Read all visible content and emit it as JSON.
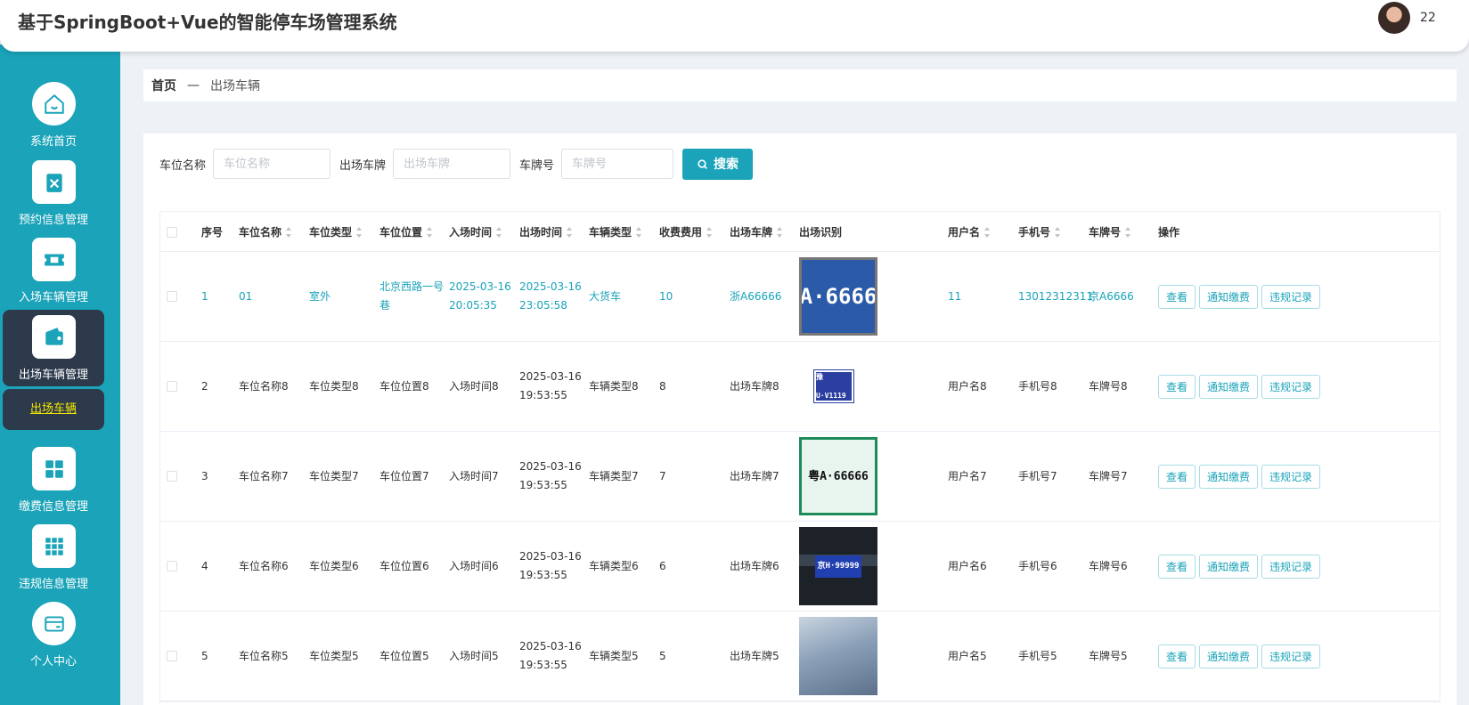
{
  "header": {
    "title": "基于SpringBoot+Vue的智能停车场管理系统",
    "user_name": "22"
  },
  "sidebar": {
    "items": [
      {
        "label": "系统首页",
        "icon": "home-icon"
      },
      {
        "label": "预约信息管理",
        "icon": "clipboard-icon"
      },
      {
        "label": "入场车辆管理",
        "icon": "ticket-icon"
      },
      {
        "label": "出场车辆管理",
        "icon": "wallet-icon"
      },
      {
        "label": "缴费信息管理",
        "icon": "grid-icon"
      },
      {
        "label": "违规信息管理",
        "icon": "grid-nine-icon"
      },
      {
        "label": "个人中心",
        "icon": "card-icon"
      }
    ],
    "sub_item": {
      "label": "出场车辆"
    }
  },
  "breadcrumb": {
    "home": "首页",
    "separator": "—",
    "current": "出场车辆"
  },
  "search": {
    "fields": [
      {
        "label": "车位名称",
        "placeholder": "车位名称"
      },
      {
        "label": "出场车牌",
        "placeholder": "出场车牌"
      },
      {
        "label": "车牌号",
        "placeholder": "车牌号"
      }
    ],
    "button": "搜索"
  },
  "table": {
    "headers": {
      "index": "序号",
      "spot_name": "车位名称",
      "spot_type": "车位类型",
      "spot_location": "车位位置",
      "entry_time": "入场时间",
      "exit_time": "出场时间",
      "vehicle_type": "车辆类型",
      "fee": "收费费用",
      "exit_plate": "出场车牌",
      "exit_recognition": "出场识别",
      "username": "用户名",
      "phone": "手机号",
      "plate_no": "车牌号",
      "actions": "操作"
    },
    "rows": [
      {
        "index": "1",
        "spot_name": "01",
        "spot_type": "室外",
        "spot_location": "北京西路一号巷",
        "entry_time": "2025-03-16 20:05:35",
        "exit_time": "2025-03-16 23:05:58",
        "vehicle_type": "大货车",
        "fee": "10",
        "exit_plate": "浙A66666",
        "plate_image_text": "A·6666",
        "username": "11",
        "phone": "13012312311",
        "plate_no": "京A6666"
      },
      {
        "index": "2",
        "spot_name": "车位名称8",
        "spot_type": "车位类型8",
        "spot_location": "车位位置8",
        "entry_time": "入场时间8",
        "exit_time": "2025-03-16 19:53:55",
        "vehicle_type": "车辆类型8",
        "fee": "8",
        "exit_plate": "出场车牌8",
        "plate_image_text": "豫U·V1119",
        "username": "用户名8",
        "phone": "手机号8",
        "plate_no": "车牌号8"
      },
      {
        "index": "3",
        "spot_name": "车位名称7",
        "spot_type": "车位类型7",
        "spot_location": "车位位置7",
        "entry_time": "入场时间7",
        "exit_time": "2025-03-16 19:53:55",
        "vehicle_type": "车辆类型7",
        "fee": "7",
        "exit_plate": "出场车牌7",
        "plate_image_text": "粤A·66666",
        "username": "用户名7",
        "phone": "手机号7",
        "plate_no": "车牌号7"
      },
      {
        "index": "4",
        "spot_name": "车位名称6",
        "spot_type": "车位类型6",
        "spot_location": "车位位置6",
        "entry_time": "入场时间6",
        "exit_time": "2025-03-16 19:53:55",
        "vehicle_type": "车辆类型6",
        "fee": "6",
        "exit_plate": "出场车牌6",
        "plate_image_text": "京H·99999",
        "username": "用户名6",
        "phone": "手机号6",
        "plate_no": "车牌号6"
      },
      {
        "index": "5",
        "spot_name": "车位名称5",
        "spot_type": "车位类型5",
        "spot_location": "车位位置5",
        "entry_time": "入场时间5",
        "exit_time": "2025-03-16 19:53:55",
        "vehicle_type": "车辆类型5",
        "fee": "5",
        "exit_plate": "出场车牌5",
        "plate_image_text": "",
        "username": "用户名5",
        "phone": "手机号5",
        "plate_no": "车牌号5"
      }
    ],
    "actions": {
      "view": "查看",
      "notify": "通知缴费",
      "violation": "违规记录"
    }
  },
  "colors": {
    "primary": "#1aa3b9",
    "sidebar_active": "#2c3a4b",
    "sub_item_text": "#f5e600"
  }
}
